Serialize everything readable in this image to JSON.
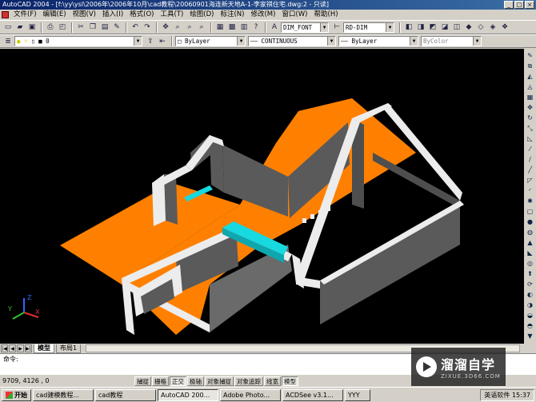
{
  "window": {
    "title": "AutoCAD 2004 - [f:\\yy\\ysl\\2006年\\2006年10月\\cad教程\\20060901海连新天地A-1-李家祺住宅.dwg:2 - 只读]",
    "min": "_",
    "max": "□",
    "close": "×"
  },
  "menu": [
    "文件(F)",
    "编辑(E)",
    "视图(V)",
    "插入(I)",
    "格式(O)",
    "工具(T)",
    "绘图(D)",
    "标注(N)",
    "修改(M)",
    "窗口(W)",
    "帮助(H)"
  ],
  "toolbar1": {
    "textstyle": "DIM_FONT",
    "dimstyle": "RD-DIM"
  },
  "toolbar2": {
    "layer": "0",
    "color": "ByLayer",
    "linetype": "CONTINUOUS",
    "lineweight": "ByLayer",
    "plotstyle": "ByColor"
  },
  "viewport": {
    "background": "#000000",
    "floor_color": "#ff8000",
    "wall_top_color": "#ececec",
    "wall_side_color": "#5a5a5a",
    "beam_color": "#18d8e0",
    "ucs": {
      "x": "X",
      "y": "Y",
      "z": "Z"
    }
  },
  "tabs": {
    "model": "模型",
    "layout1": "布局1"
  },
  "command": {
    "prompt": "命令:",
    "history": ""
  },
  "status": {
    "coords": "9709, 4126 , 0",
    "buttons": [
      "捕捉",
      "栅格",
      "正交",
      "极轴",
      "对象捕捉",
      "对象追踪",
      "线宽",
      "模型"
    ],
    "active": [
      2,
      7
    ]
  },
  "taskbar": {
    "start": "开始",
    "tasks": [
      "cad建模教程...",
      "cad教程",
      "AutoCAD 200...",
      "Adobe Photo...",
      "ACDSee v3.1...",
      "YYY"
    ],
    "active_task": 2,
    "tray_app": "英语软件",
    "time": "15:37"
  },
  "watermark": {
    "name": "溜溜自学",
    "url": "ZIXUE.3D66.COM"
  }
}
